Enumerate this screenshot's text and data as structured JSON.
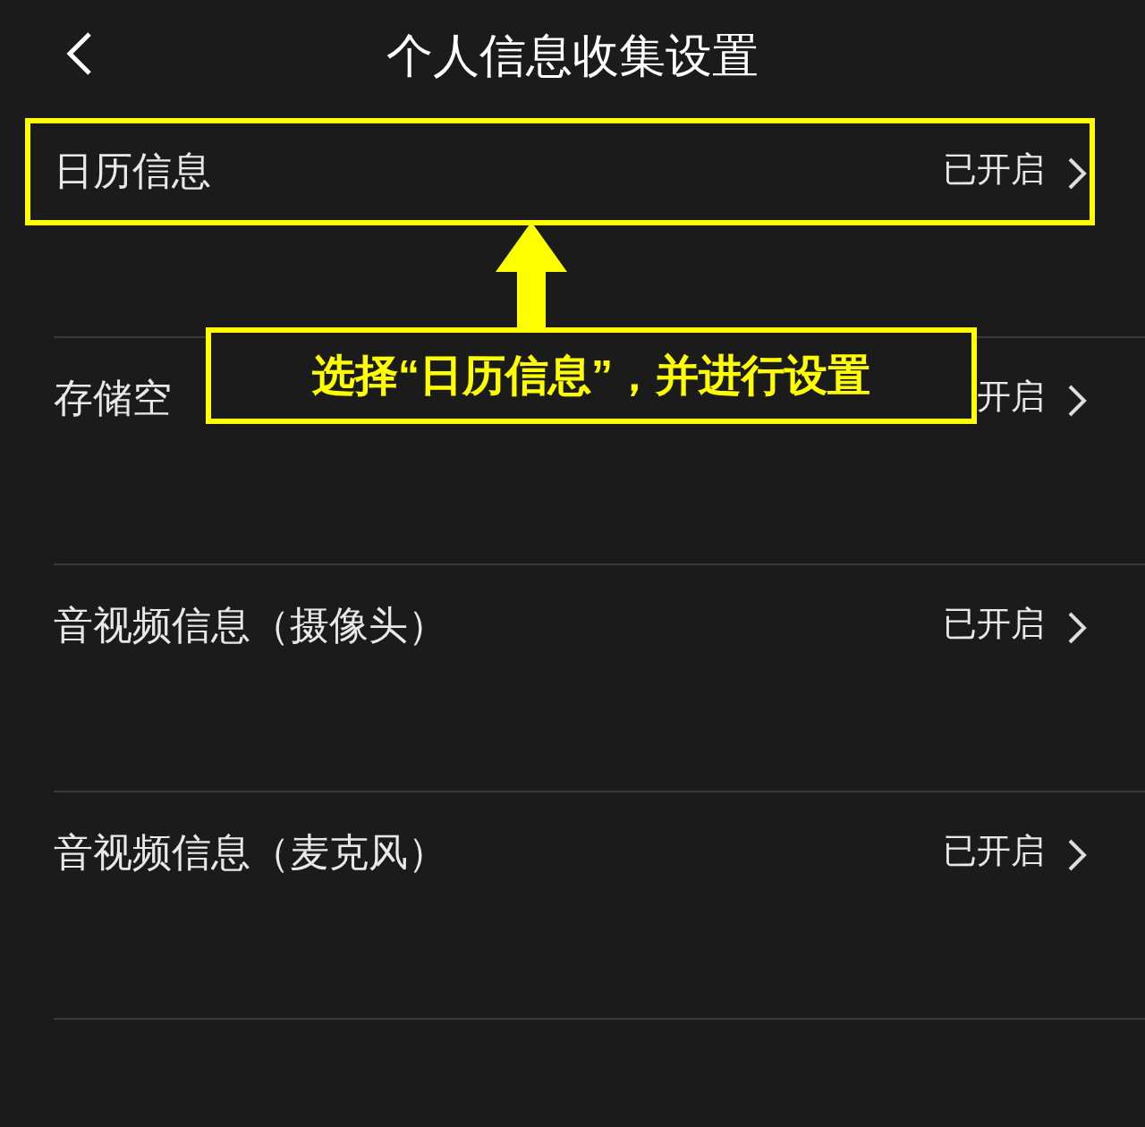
{
  "header": {
    "title": "个人信息收集设置"
  },
  "rows": [
    {
      "label": "日历信息",
      "status": "已开启",
      "highlighted": true
    },
    {
      "label": "存储空",
      "status": "开启",
      "highlighted": false
    },
    {
      "label": "音视频信息（摄像头）",
      "status": "已开启",
      "highlighted": false
    },
    {
      "label": "音视频信息（麦克风）",
      "status": "已开启",
      "highlighted": false
    }
  ],
  "callout": {
    "text": "选择“日历信息”，并进行设置"
  }
}
